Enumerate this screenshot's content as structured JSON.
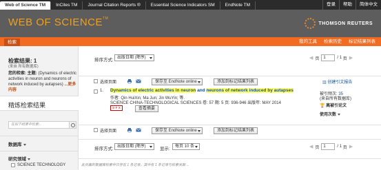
{
  "topnav": {
    "tabs": [
      "Web of Science TM",
      "InCites TM",
      "Journal Citation Reports ®",
      "Essential Science Indicators SM",
      "EndNote TM"
    ],
    "right": [
      "登录",
      "帮助",
      "简体中文"
    ]
  },
  "banner": {
    "logo": "WEB OF SCIENCE",
    "logo_tm": "TM",
    "publisher": "THOMSON REUTERS"
  },
  "subbar": {
    "search_tab": "检索",
    "links": [
      "我的工具",
      "检索历史",
      "标记结果列表"
    ]
  },
  "sidebar": {
    "title": "检索结果: 1",
    "subtitle": "(来自 所有数据库)",
    "query_label": "您的检索: 主题:",
    "query_text": "(Dynamics of electric activities in neuron and neurons of network induced by autapses)",
    "more": "...更多内容",
    "refine": "精炼检索结果",
    "search_placeholder": "在如下结果中检索...",
    "database_label": "数据库",
    "research_area_label": "研究领域",
    "research_area_item": "SCIENCE TECHNOLOGY"
  },
  "main": {
    "sort_label": "排序方式:",
    "sort_value": "出版日期 (降序)",
    "page_current": "1",
    "page_total": "1",
    "page_of": "/",
    "page_suffix": "页",
    "select_page": "选择页面",
    "save_endnote": "保存至 EndNote online",
    "add_marked": "添加到标记结果列表",
    "create_citation": "创建引文报告",
    "display_label": "显示:",
    "display_value": "每页 10 条",
    "bottom_note": "此页面的数据库检索中只存在 1 条记录。其中有 1 条记录与检索关联 ..."
  },
  "record": {
    "number": "1.",
    "title_parts": [
      "Dynamics of electric activities in neuron",
      " and ",
      "neurons of network induced by autapses"
    ],
    "authors": "作者: Qin HuiXin; Ma Jun; Jin WuYin; 等.",
    "source": "SCIENCE CHINA-TECHNOLOGICAL SCIENCES  卷: 57  期: 5  页: 936-946  出版年: MAY 2014",
    "badge": "S·F·X",
    "abstract_btn": "查看摘要",
    "cited_label": "被引频次:",
    "cited_value": "35",
    "cited_source": "(来自所有数据库)",
    "highly_cited": "高被引论文",
    "usage": "使用次数"
  }
}
